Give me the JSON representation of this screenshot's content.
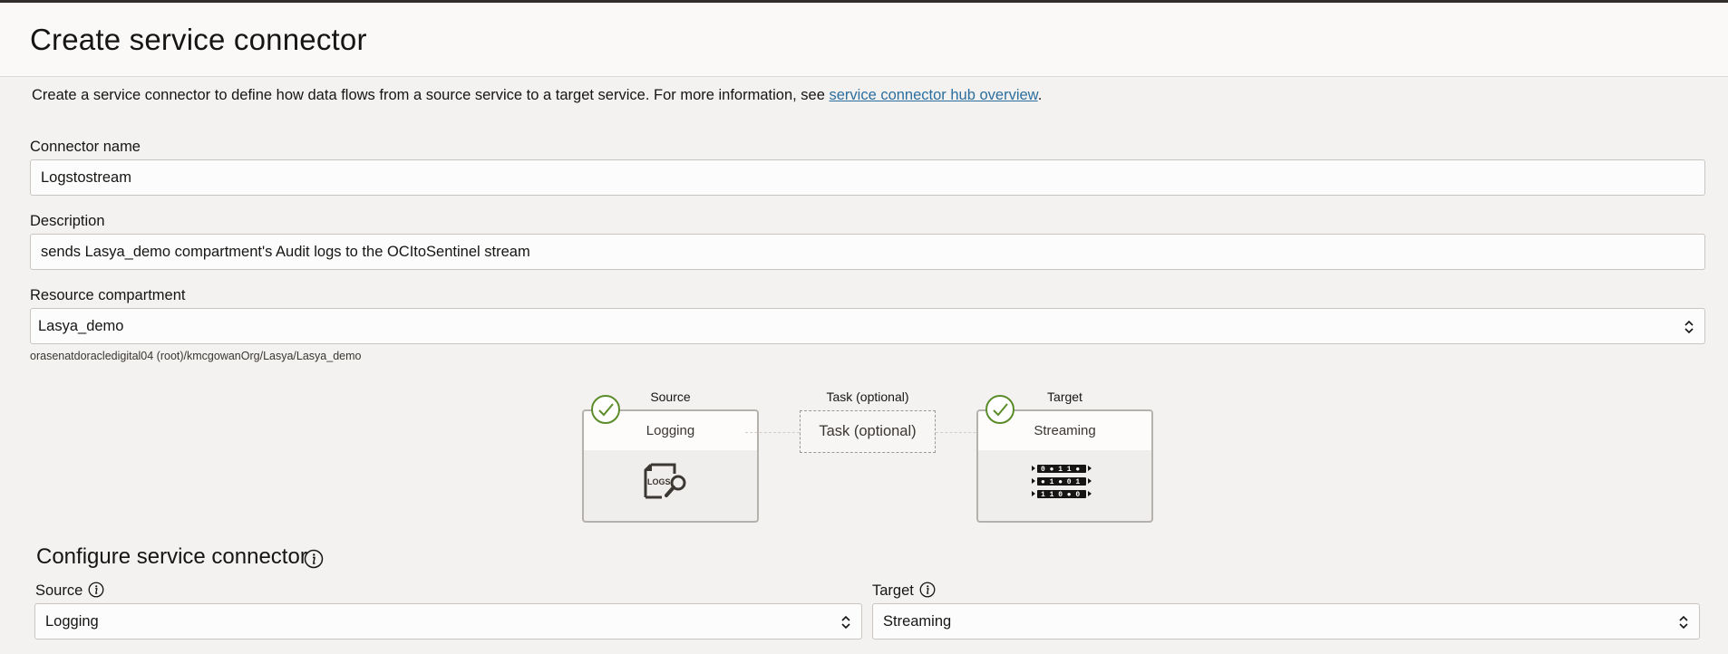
{
  "header": {
    "title": "Create service connector"
  },
  "intro": {
    "text": "Create a service connector to define how data flows from a source service to a target service. For more information, see ",
    "link": "service connector hub overview",
    "suffix": "."
  },
  "connector_name": {
    "label": "Connector name",
    "value": "Logstostream"
  },
  "description": {
    "label": "Description",
    "value": "sends Lasya_demo compartment's Audit logs to the OCItoSentinel stream"
  },
  "compartment": {
    "label": "Resource compartment",
    "value": "Lasya_demo",
    "path": "orasenatdoracledigital04 (root)/kmcgowanOrg/Lasya/Lasya_demo"
  },
  "flow": {
    "source": {
      "title": "Source",
      "card_label": "Logging",
      "icon": "logs-search-icon"
    },
    "task": {
      "title": "Task (optional)",
      "box_label": "Task (optional)"
    },
    "target": {
      "title": "Target",
      "card_label": "Streaming",
      "icon": "stream-bits-icon"
    },
    "stream_rows": [
      "0 ● 1 1 ●",
      "● 1 ● 0 1",
      "1 1 0 ● 0"
    ]
  },
  "configure": {
    "title": "Configure service connector",
    "source_label": "Source",
    "source_value": "Logging",
    "target_label": "Target",
    "target_value": "Streaming"
  },
  "colors": {
    "link": "#2b6e9e",
    "check": "#5b8c2a",
    "background": "#f3f2f1"
  }
}
